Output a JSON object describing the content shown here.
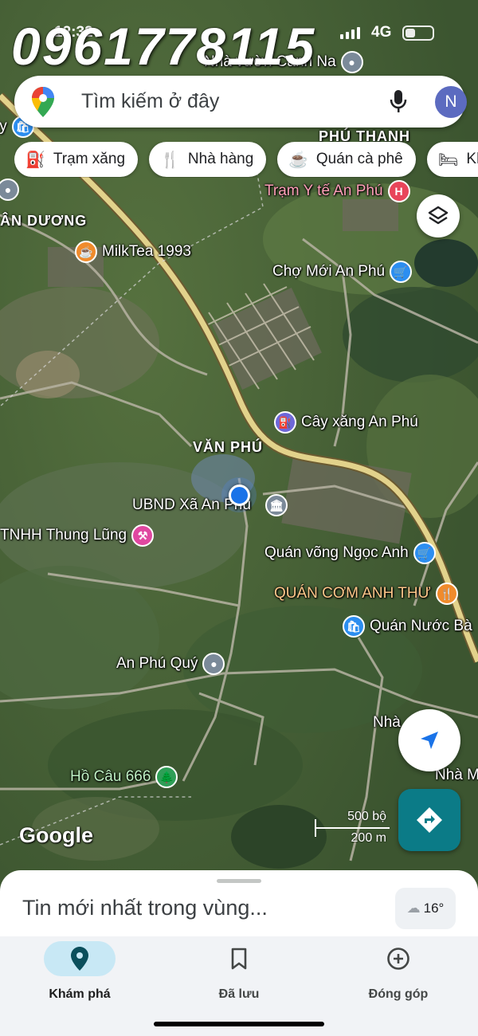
{
  "watermark": "0961778115",
  "status_bar": {
    "time": "12:32",
    "network": "4G"
  },
  "search": {
    "placeholder": "Tìm kiếm ở đây",
    "avatar_letter": "N"
  },
  "chips": [
    {
      "label": "Trạm xăng",
      "icon": "gas-station-icon"
    },
    {
      "label": "Nhà hàng",
      "icon": "restaurant-icon"
    },
    {
      "label": "Quán cà phê",
      "icon": "coffee-icon"
    },
    {
      "label": "Khách sạn",
      "icon": "hotel-icon"
    }
  ],
  "map": {
    "areas": [
      "ÂN DƯƠNG",
      "PHÚ THANH",
      "VĂN PHÚ"
    ],
    "pois": [
      {
        "name": "Nhà vườn Cảnh Na",
        "icon": "pin-icon"
      },
      {
        "name": "Trạm Y tế An Phú",
        "icon": "hospital-icon"
      },
      {
        "name": "MilkTea 1993",
        "icon": "cafe-icon"
      },
      {
        "name": "Chợ Mới An Phú",
        "icon": "shopping-icon"
      },
      {
        "name": "Cây xăng An Phú",
        "icon": "gas-icon"
      },
      {
        "name": "UBND Xã An Phú",
        "icon": "government-icon"
      },
      {
        "name": "TNHH Thung Lũng",
        "icon": "tools-icon"
      },
      {
        "name": "Quán võng Ngọc Anh",
        "icon": "shopping-icon"
      },
      {
        "name": "QUÁN CƠM ANH THƯ",
        "icon": "restaurant-icon"
      },
      {
        "name": "Quán Nước Bà",
        "icon": "shop-icon"
      },
      {
        "name": "An Phú Quý",
        "icon": "pin-icon"
      },
      {
        "name": "Hồ Câu 666",
        "icon": "park-icon"
      },
      {
        "name": "Nhà",
        "icon": "pin-icon"
      },
      {
        "name": "Nhà M",
        "icon": "pin-icon"
      },
      {
        "name": "ty",
        "icon": "pin-icon"
      }
    ],
    "attribution": "Google",
    "scale": {
      "imperial": "500 bộ",
      "metric": "200 m"
    }
  },
  "sheet": {
    "title": "Tin mới nhất trong vùng...",
    "weather": "16°"
  },
  "nav": [
    {
      "label": "Khám phá",
      "icon": "explore-pin-icon",
      "active": true
    },
    {
      "label": "Đã lưu",
      "icon": "bookmark-icon",
      "active": false
    },
    {
      "label": "Đóng góp",
      "icon": "add-circle-icon",
      "active": false
    }
  ],
  "colors": {
    "accent": "#1a73e8",
    "directions": "#0b7b87",
    "nav_active": "#c8e8f5"
  }
}
